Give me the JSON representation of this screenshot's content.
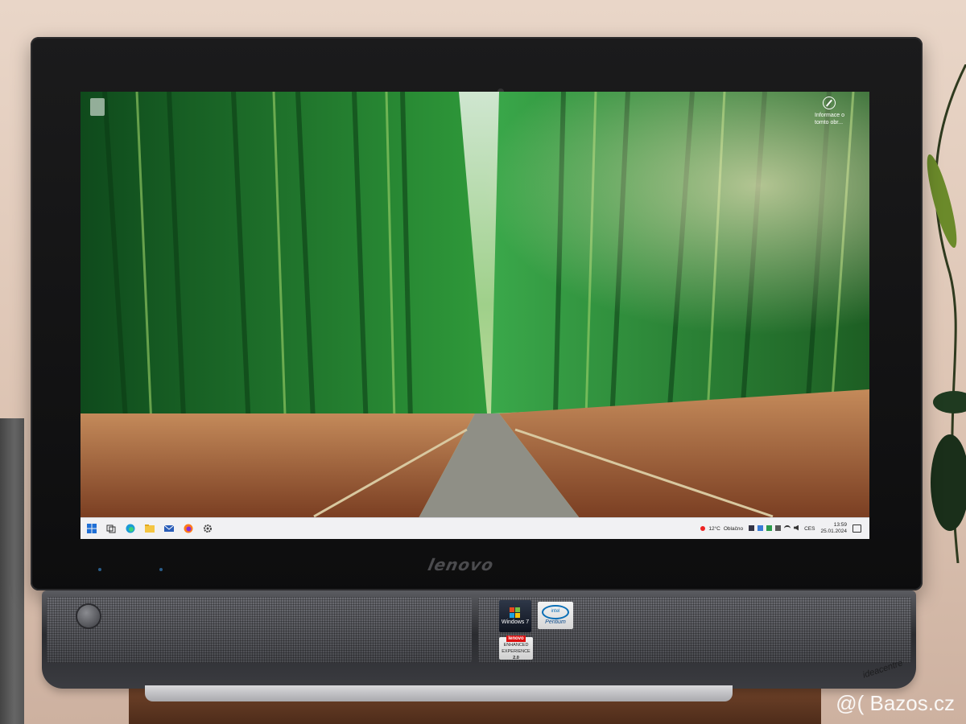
{
  "screen": {
    "info_widget": {
      "line1": "Informace o",
      "line2": "tomto obr..."
    },
    "taskbar": {
      "icons": [
        "windows-start-icon",
        "task-view-icon",
        "edge-icon",
        "file-explorer-icon",
        "mail-icon",
        "firefox-icon",
        "settings-icon"
      ],
      "weather_temp": "12°C",
      "weather_text": "Oblačno",
      "lang": "CES",
      "time": "13:59",
      "date": "25.01.2024"
    }
  },
  "bezel": {
    "brand": "lenovo"
  },
  "stickers": {
    "windows": "Windows 7",
    "intel_brand": "intel",
    "intel_product": "Pentium",
    "enhanced_brand": "lenovo",
    "enhanced_text": "ENHANCED EXPERIENCE",
    "enhanced_version": "2.0"
  },
  "speaker": {
    "series": "ideacentre"
  },
  "watermark": {
    "text": "@( Bazos.cz"
  },
  "colors": {
    "bamboo": "#2e8b3a",
    "grass": "#a0623a",
    "path": "#9a9a92",
    "taskbar": "#f1f1f3"
  }
}
